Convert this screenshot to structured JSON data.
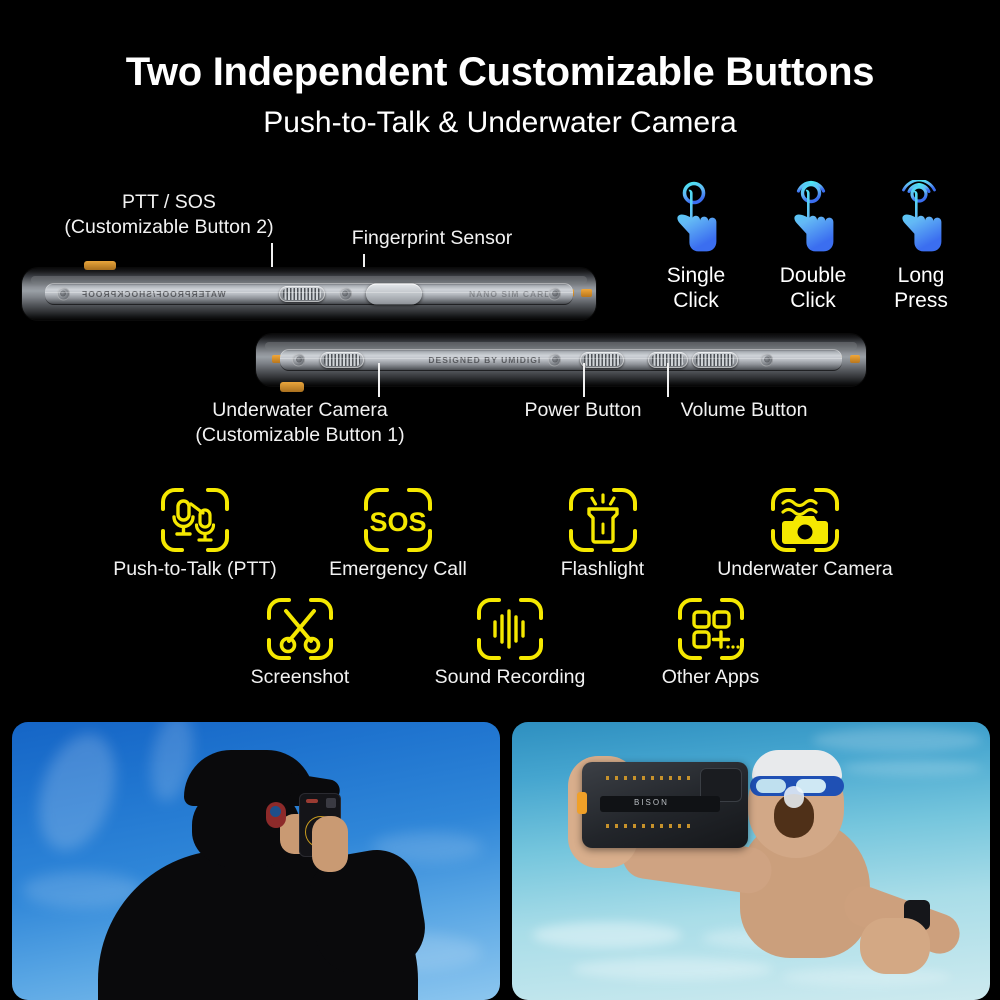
{
  "headings": {
    "title": "Two Independent Customizable Buttons",
    "subtitle": "Push-to-Talk & Underwater Camera"
  },
  "colors": {
    "background": "#000000",
    "text": "#ffffff",
    "feature_icon_yellow": "#f5e800",
    "gesture_icon_cyan": "#46e6f0",
    "gesture_icon_blue": "#3b7df0",
    "phone_accent_orange": "#e9a63c"
  },
  "phone_top": {
    "engraving": "WATERPROOF/SHOCKPROOF",
    "engraving_right": "NANO SIM CARD",
    "callouts": [
      {
        "line1": "PTT / SOS",
        "line2": "(Customizable Button 2)"
      },
      {
        "line1": "Fingerprint Sensor",
        "line2": ""
      }
    ]
  },
  "phone_bottom": {
    "engraving": "DESIGNED BY UMIDIGI",
    "callouts": [
      {
        "line1": "Underwater Camera",
        "line2": "(Customizable Button 1)"
      },
      {
        "line1": "Power Button",
        "line2": ""
      },
      {
        "line1": "Volume Button",
        "line2": ""
      }
    ]
  },
  "gestures": [
    {
      "icon": "single-click-hand-icon",
      "line1": "Single",
      "line2": "Click",
      "arcs": 1
    },
    {
      "icon": "double-click-hand-icon",
      "line1": "Double",
      "line2": "Click",
      "arcs": 2
    },
    {
      "icon": "long-press-hand-icon",
      "line1": "Long",
      "line2": "Press",
      "arcs": 3
    }
  ],
  "features_row1": [
    {
      "icon": "push-to-talk-icon",
      "label": "Push-to-Talk (PTT)"
    },
    {
      "icon": "sos-icon",
      "label": "Emergency Call",
      "glyph": "SOS"
    },
    {
      "icon": "flashlight-icon",
      "label": "Flashlight"
    },
    {
      "icon": "underwater-camera-icon",
      "label": "Underwater Camera"
    }
  ],
  "features_row2": [
    {
      "icon": "screenshot-scissors-icon",
      "label": "Screenshot"
    },
    {
      "icon": "sound-recording-icon",
      "label": "Sound Recording"
    },
    {
      "icon": "other-apps-grid-icon",
      "label": "Other Apps"
    }
  ],
  "photos": [
    {
      "name": "ptt-outdoor-photo",
      "description": "Man seen from behind wearing a black cap and dark jacket, holding a rugged phone running a push-to-talk app against a blue sky"
    },
    {
      "name": "underwater-photo",
      "description": "Bearded swimmer with blue goggles underwater in a pool holding a BISON rugged phone toward the camera",
      "phone_logo": "BISON"
    }
  ]
}
